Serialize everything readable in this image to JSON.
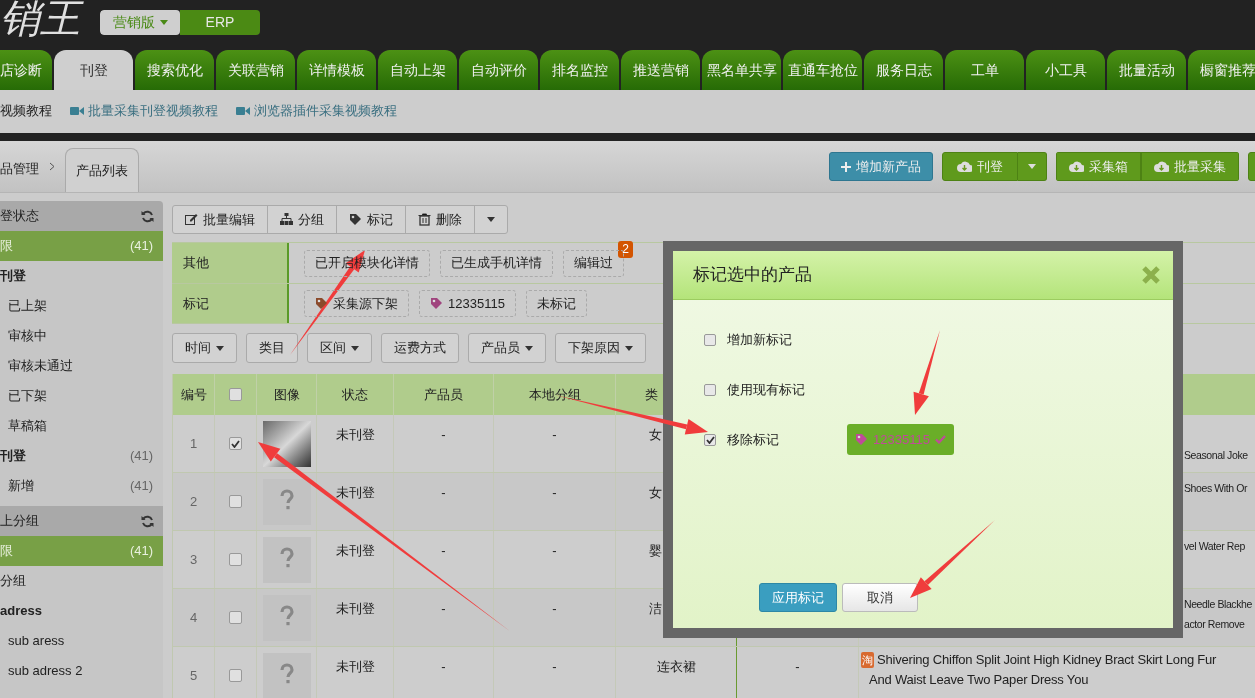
{
  "logo": "销王",
  "versions": [
    {
      "label": "营销版",
      "selected": true,
      "dropdown": true
    },
    {
      "label": "ERP",
      "selected": false,
      "dropdown": false
    }
  ],
  "nav_tabs": [
    {
      "label": "店诊断",
      "selected": false
    },
    {
      "label": "刊登",
      "selected": true
    },
    {
      "label": "搜索优化",
      "selected": false
    },
    {
      "label": "关联营销",
      "selected": false
    },
    {
      "label": "详情模板",
      "selected": false
    },
    {
      "label": "自动上架",
      "selected": false
    },
    {
      "label": "自动评价",
      "selected": false
    },
    {
      "label": "排名监控",
      "selected": false
    },
    {
      "label": "推送营销",
      "selected": false
    },
    {
      "label": "黑名单共享",
      "selected": false
    },
    {
      "label": "直通车抢位",
      "selected": false
    },
    {
      "label": "服务日志",
      "selected": false
    },
    {
      "label": "工单",
      "selected": false
    },
    {
      "label": "小工具",
      "selected": false
    },
    {
      "label": "批量活动",
      "selected": false
    },
    {
      "label": "橱窗推荐",
      "selected": false
    }
  ],
  "tutorial_links": [
    {
      "label": "视频教程",
      "video": false
    },
    {
      "label": "批量采集刊登视频教程",
      "video": true
    },
    {
      "label": "浏览器插件采集视频教程",
      "video": true
    }
  ],
  "breadcrumb": {
    "parent": "品管理",
    "current": "产品列表"
  },
  "actions": [
    {
      "label": "增加新产品",
      "kind": "primary"
    },
    {
      "label": "刊登",
      "kind": "split"
    },
    {
      "label": "采集箱",
      "kind": "group"
    },
    {
      "label": "批量采集",
      "kind": "group"
    },
    {
      "kind": "edge"
    }
  ],
  "sidebar": [
    {
      "title": "登状态",
      "items": [
        {
          "label": "限",
          "count": "(41)",
          "selected": true
        },
        {
          "label": "刊登",
          "selected": false,
          "children": [
            {
              "label": "已上架",
              "selected": false
            },
            {
              "label": "审核中",
              "selected": false
            },
            {
              "label": "审核未通过",
              "selected": false
            },
            {
              "label": "已下架",
              "selected": false
            },
            {
              "label": "草稿箱",
              "selected": false
            }
          ]
        },
        {
          "label": "刊登",
          "count": "(41)",
          "selected": false,
          "children": [
            {
              "label": "新增",
              "count": "(41)",
              "selected": false
            }
          ]
        }
      ]
    },
    {
      "title": "上分组",
      "items": [
        {
          "label": "限",
          "count": "(41)",
          "selected": true
        },
        {
          "label": "分组",
          "selected": false
        },
        {
          "label": "adress",
          "selected": false,
          "children": [
            {
              "label": "sub aress",
              "selected": false
            },
            {
              "label": "sub adress 2",
              "selected": false
            }
          ]
        }
      ]
    }
  ],
  "toolbar": [
    {
      "label": "批量编辑",
      "kind": "action"
    },
    {
      "label": "分组",
      "kind": "action"
    },
    {
      "label": "标记",
      "kind": "action"
    },
    {
      "label": "删除",
      "kind": "action"
    },
    {
      "kind": "dropdown"
    }
  ],
  "filters": [
    {
      "label": "其他",
      "options": [
        {
          "label": "已开启模块化详情"
        },
        {
          "label": "已生成手机详情"
        },
        {
          "label": "编辑过",
          "badge": "2"
        }
      ]
    },
    {
      "label": "标记",
      "options": [
        {
          "label": "采集源下架",
          "color": "#8b4a2b"
        },
        {
          "label": "12335115",
          "color": "#a0457e"
        },
        {
          "label": "未标记"
        }
      ]
    }
  ],
  "filter_buttons": [
    {
      "label": "时间",
      "dropdown": true
    },
    {
      "label": "类目",
      "dropdown": false
    },
    {
      "label": "区间",
      "dropdown": true
    },
    {
      "label": "运费方式",
      "dropdown": false
    },
    {
      "label": "产品员",
      "dropdown": true
    },
    {
      "label": "下架原因",
      "dropdown": true
    }
  ],
  "table": {
    "columns": [
      "编号",
      "图像",
      "状态",
      "产品员",
      "本地分组",
      "类"
    ],
    "select_all": false,
    "rows": [
      {
        "number": "1",
        "checked": true,
        "has_photo": true,
        "status": "未刊登",
        "staff": "-",
        "group": "-",
        "category": "女",
        "title_lines": [
          "Seasonal Joke"
        ]
      },
      {
        "number": "2",
        "checked": false,
        "has_photo": false,
        "status": "未刊登",
        "staff": "-",
        "group": "-",
        "category": "女",
        "title_lines": [
          "Shoes With Or"
        ]
      },
      {
        "number": "3",
        "checked": false,
        "has_photo": false,
        "status": "未刊登",
        "staff": "-",
        "group": "-",
        "category": "婴",
        "title_lines": [
          "vel Water Rep"
        ]
      },
      {
        "number": "4",
        "checked": false,
        "has_photo": false,
        "status": "未刊登",
        "staff": "-",
        "group": "-",
        "category": "洁",
        "title_lines": [
          "Needle Blackhe",
          "actor Remove"
        ]
      },
      {
        "number": "5",
        "checked": false,
        "has_photo": false,
        "status": "未刊登",
        "staff": "-",
        "group": "-",
        "category": "连衣裙",
        "column_8": "-",
        "source_badge": "淘",
        "title_lines": [
          "Shivering Chiffon Split Joint High Kidney Bract Skirt Long Fur",
          "And Waist Leave Two Paper Dress You"
        ]
      }
    ]
  },
  "dialog": {
    "title": "标记选中的产品",
    "options": [
      {
        "label": "增加新标记",
        "checked": false
      },
      {
        "label": "使用现有标记",
        "checked": false
      },
      {
        "label": "移除标记",
        "checked": true,
        "tag": {
          "label": "12335115",
          "color": "#c04a9a",
          "selected": true
        }
      }
    ],
    "buttons": [
      {
        "label": "应用标记",
        "kind": "primary"
      },
      {
        "label": "取消",
        "kind": "default"
      }
    ]
  }
}
